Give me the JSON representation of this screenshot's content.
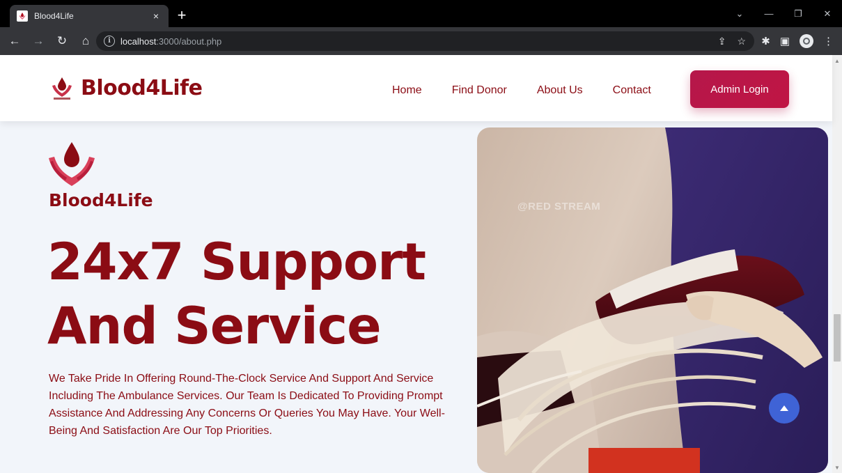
{
  "browser": {
    "tab_title": "Blood4Life",
    "url_host": "localhost",
    "url_rest": ":3000/about.php",
    "tab_close": "×",
    "new_tab": "+"
  },
  "header": {
    "brand_name": "Blood4Life",
    "nav": [
      "Home",
      "Find Donor",
      "About Us",
      "Contact"
    ],
    "admin_login": "Admin Login"
  },
  "hero": {
    "brand": "Blood4Life",
    "title_line1": "24x7 Support",
    "title_line2": "And Service",
    "description": "We Take Pride In Offering Round-The-Clock Service And Support And Service Including The Ambulance Services. Our Team Is Dedicated To Providing Prompt Assistance And Addressing Any Concerns Or Queries You May Have. Your Well-Being And Satisfaction Are Our Top Priorities.",
    "image_watermark": "@RED STREAM"
  },
  "colors": {
    "brand": "#8b0c14",
    "accent": "#c01544",
    "scroll_button": "#3f63d6",
    "page_bg": "#f2f5fa"
  },
  "icons": [
    "back-icon",
    "forward-icon",
    "reload-icon",
    "home-icon",
    "info-icon",
    "share-icon",
    "star-icon",
    "extensions-icon",
    "sidepanel-icon",
    "profile-icon",
    "menu-icon",
    "arrow-up-icon"
  ]
}
